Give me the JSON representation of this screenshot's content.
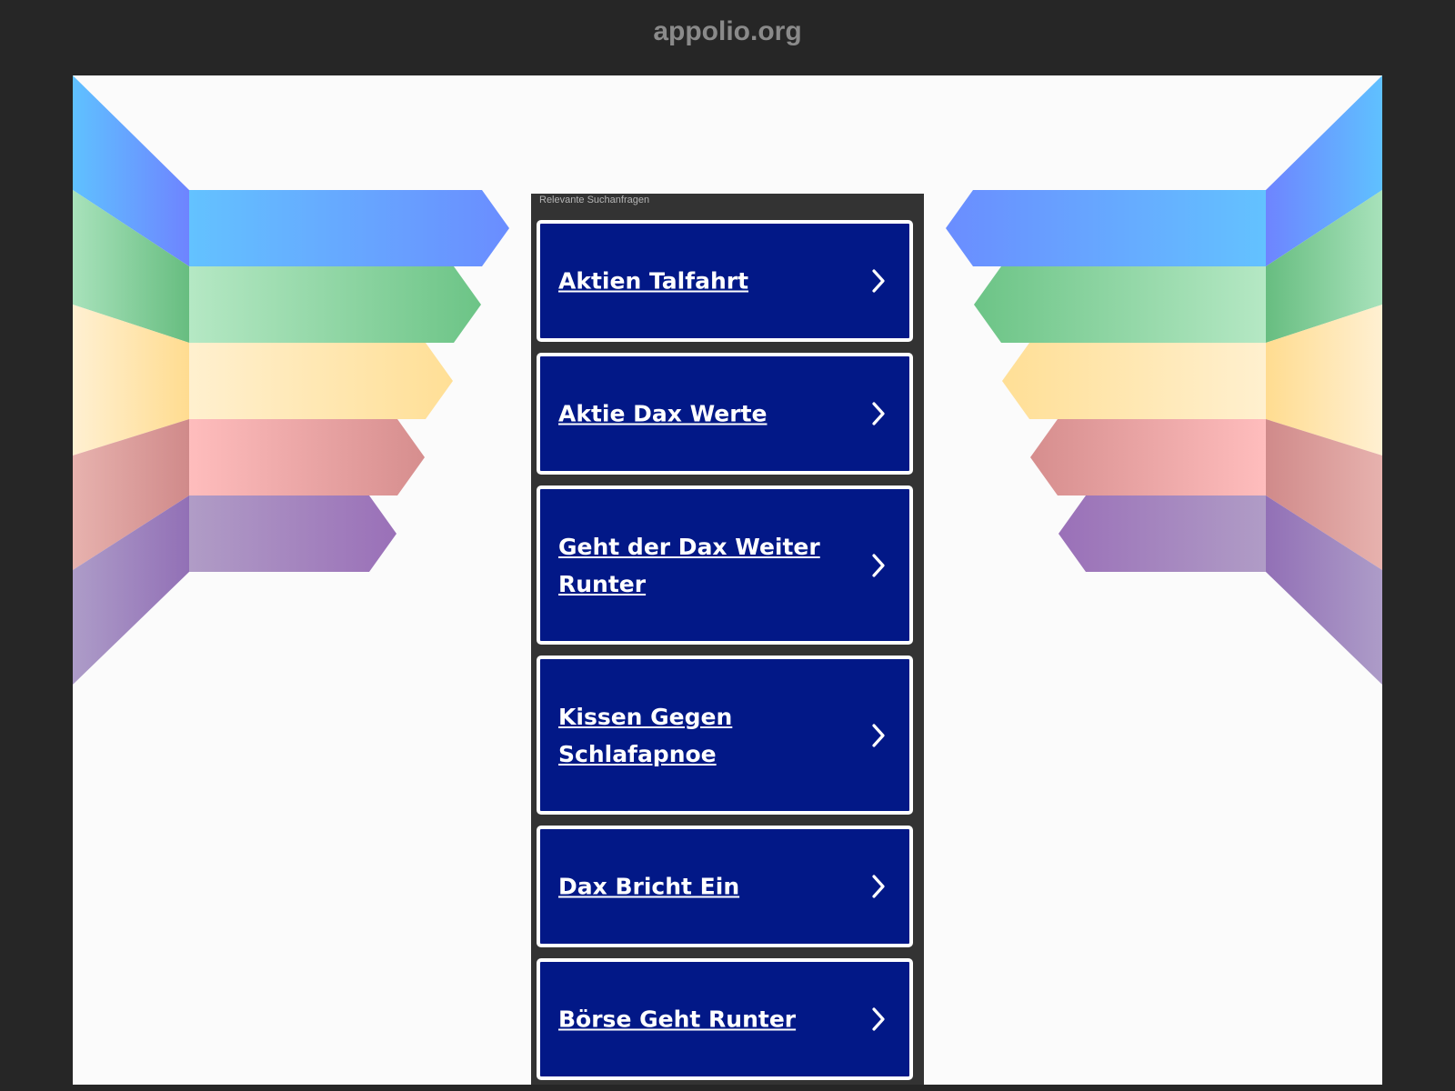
{
  "header": {
    "domain": "appolio.org"
  },
  "results": {
    "heading": "Relevante Suchanfragen",
    "items": [
      {
        "label": "Aktien Talfahrt"
      },
      {
        "label": "Aktie Dax Werte"
      },
      {
        "label": "Geht der Dax Weiter Runter"
      },
      {
        "label": "Kissen Gegen Schlafapnoe"
      },
      {
        "label": "Dax Bricht Ein"
      },
      {
        "label": "Börse Geht Runter"
      }
    ],
    "arrow_icon": "chevron-right-icon"
  },
  "colors": {
    "background": "#262626",
    "panel": "#fbfbfb",
    "result_bg": "#021887",
    "result_border": "#ffffff",
    "results_container": "#333333",
    "domain_text": "#8a8a8a",
    "stripes": [
      "#5b8bff",
      "#6bc586",
      "#ffe3a0",
      "#d98a8a",
      "#9a72b8"
    ]
  }
}
